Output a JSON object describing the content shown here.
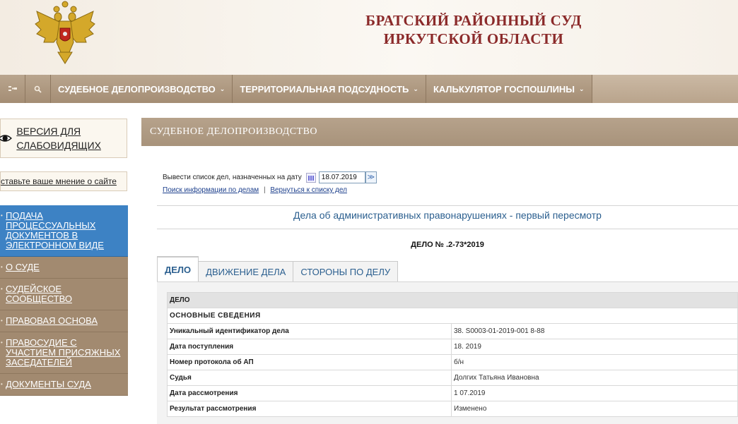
{
  "header": {
    "title_line1": "БРАТСКИЙ РАЙОННЫЙ СУД",
    "title_line2": "ИРКУТСКОЙ ОБЛАСТИ"
  },
  "nav": {
    "icons": [
      "sitemap-icon",
      "search-icon"
    ],
    "items": [
      {
        "label": "СУДЕБНОЕ ДЕЛОПРОИЗВОДСТВО"
      },
      {
        "label": "ТЕРРИТОРИАЛЬНАЯ ПОДСУДНОСТЬ"
      },
      {
        "label": "КАЛЬКУЛЯТОР ГОСПОШЛИНЫ"
      }
    ]
  },
  "sidebar": {
    "accessibility_label": "ВЕРСИЯ ДЛЯ СЛАБОВИДЯЩИХ",
    "opinion_link": "ставьте ваше мнение о сайте",
    "menu": [
      {
        "label": "ПОДАЧА ПРОЦЕССУАЛЬНЫХ ДОКУМЕНТОВ В ЭЛЕКТРОННОМ ВИДЕ",
        "active": true
      },
      {
        "label": "О СУДЕ"
      },
      {
        "label": "СУДЕЙСКОЕ СООБЩЕСТВО"
      },
      {
        "label": "ПРАВОВАЯ ОСНОВА"
      },
      {
        "label": "ПРАВОСУДИЕ С УЧАСТИЕМ ПРИСЯЖНЫХ ЗАСЕДАТЕЛЕЙ"
      },
      {
        "label": "ДОКУМЕНТЫ СУДА"
      }
    ]
  },
  "content": {
    "heading": "СУДЕБНОЕ ДЕЛОПРОИЗВОДСТВО",
    "date_prompt": "Вывести список дел, назначенных на дату",
    "date_value": "18.07.2019",
    "go_symbol": "≫",
    "link_search": "Поиск информации по делам",
    "link_separator": "|",
    "link_back": "Вернуться к списку дел",
    "case_category": "Дела об административных правонарушениях - первый пересмотр",
    "case_number": "ДЕЛО № .2-73*2019",
    "tabs": [
      {
        "label": "ДЕЛО",
        "active": true
      },
      {
        "label": "ДВИЖЕНИЕ ДЕЛА"
      },
      {
        "label": "СТОРОНЫ ПО ДЕЛУ"
      }
    ],
    "section_label": "ДЕЛО",
    "section_title": "ОСНОВНЫЕ СВЕДЕНИЯ",
    "rows": [
      {
        "key": "Уникальный идентификатор дела",
        "value": "38. S0003-01-2019-001 8-88"
      },
      {
        "key": "Дата поступления",
        "value": "18.  2019"
      },
      {
        "key": "Номер протокола об АП",
        "value": "б/н"
      },
      {
        "key": "Судья",
        "value": "Долгих Татьяна Ивановна"
      },
      {
        "key": "Дата рассмотрения",
        "value": "1  07.2019"
      },
      {
        "key": "Результат рассмотрения",
        "value": "Изменено"
      }
    ]
  },
  "colors": {
    "title_red": "#8b2a2a",
    "nav_brown": "#a48d74",
    "active_blue": "#3d82c4",
    "link_blue": "#1c3f8c",
    "heading_blue": "#2b5f8f"
  }
}
